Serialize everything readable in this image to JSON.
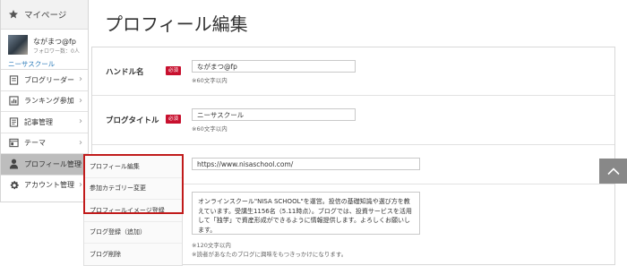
{
  "sidebar": {
    "mypage_label": "マイページ",
    "profile": {
      "name": "ながまつ@fp",
      "followers": "フォロワー数：0人",
      "blog_name": "ニーサスクール"
    },
    "items": [
      {
        "label": "ブログリーダー",
        "icon": "book-icon"
      },
      {
        "label": "ランキング参加",
        "icon": "ranking-icon"
      },
      {
        "label": "記事管理",
        "icon": "document-icon"
      },
      {
        "label": "テーマ",
        "icon": "theme-icon"
      },
      {
        "label": "プロフィール管理",
        "icon": "person-icon"
      },
      {
        "label": "アカウント管理",
        "icon": "gear-icon"
      }
    ]
  },
  "submenu": {
    "items": [
      "プロフィール編集",
      "参加カテゴリー変更",
      "プロフィールイメージ登録",
      "ブログ登録（追加）",
      "ブログ削除"
    ]
  },
  "main": {
    "title": "プロフィール編集",
    "handle": {
      "label": "ハンドル名",
      "required": "必須",
      "value": "ながまつ@fp",
      "hint": "※60文字以内"
    },
    "blog_title": {
      "label": "ブログタイトル",
      "required": "必須",
      "value": "ニーサスクール",
      "hint": "※60文字以内"
    },
    "url": {
      "value": "https://www.nisaschool.com/"
    },
    "description": {
      "value": "オンラインスクール\"NISA SCHOOL\"を運営。投信の基礎知識や選び方を教えています。受講生1156名（5.11時点）。ブログでは、投資サービスを活用して「独学」で資産形成ができるように情報提供します。よろしくお願いします。",
      "hint1": "※120文字以内",
      "hint2": "※読者があなたのブログに興味をもつきっかけになります。"
    }
  },
  "colors": {
    "required_badge": "#c8102e",
    "highlight_box": "#c11b1b",
    "link": "#2a7ab8",
    "active_menu": "#bdbdbd"
  }
}
